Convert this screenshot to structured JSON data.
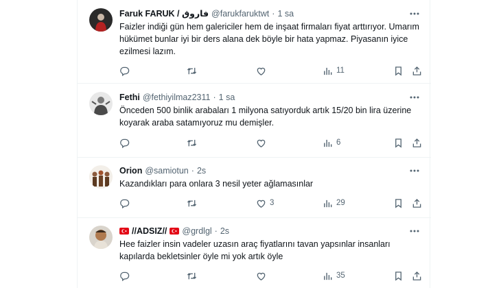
{
  "tweets": [
    {
      "name": "Faruk FARUK / فاروق",
      "handle": "@farukfaruktwt",
      "time": "1 sa",
      "text": "Faizler indiği gün hem galericiler hem de inşaat firmaları fiyat arttırıyor. Umarım hükümet bunlar iyi bir ders alana dek böyle bir hata yapmaz. Piyasanın iyice ezilmesi lazım.",
      "replies": "",
      "retweets": "",
      "likes": "",
      "views": "11"
    },
    {
      "name": "Fethi",
      "handle": "@fethiyilmaz2311",
      "time": "1 sa",
      "text": "Önceden 500 binlik arabaları 1 milyona satıyorduk artık 15/20 bin lira üzerine koyarak araba satamıyoruz mu demişler.",
      "replies": "",
      "retweets": "",
      "likes": "",
      "views": "6"
    },
    {
      "name": "Orion",
      "handle": "@samiotun",
      "time": "2s",
      "text": "Kazandıkları para onlara 3 nesil yeter ağlamasınlar",
      "replies": "",
      "retweets": "",
      "likes": "3",
      "views": "29"
    },
    {
      "name": "//ADSIZ//",
      "handle": "@grdlgl",
      "time": "2s",
      "text": "Hee faizler insin vadeler uzasın araç fiyatlarını tavan yapsınlar insanları kapılarda bekletsinler öyle mi yok artık öyle",
      "replies": "",
      "retweets": "",
      "likes": "",
      "views": "35"
    }
  ],
  "separator": "·",
  "icons": {
    "reply": "reply-icon",
    "retweet": "retweet-icon",
    "like": "like-icon",
    "views": "views-icon",
    "bookmark": "bookmark-icon",
    "share": "share-icon",
    "more": "more-icon",
    "flag": "turkey-flag-icon"
  },
  "colors": {
    "text": "#0f1419",
    "secondary": "#536471",
    "divider": "#eff3f4",
    "flag": "#e30a17"
  }
}
